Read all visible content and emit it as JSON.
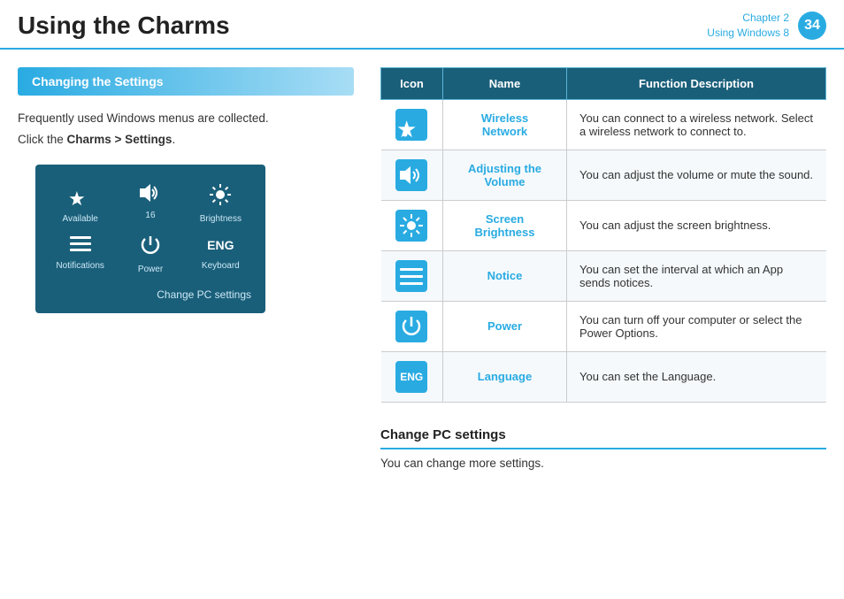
{
  "header": {
    "title": "Using the Charms",
    "chapter_line1": "Chapter 2",
    "chapter_line2": "Using Windows 8",
    "page_number": "34"
  },
  "section": {
    "heading": "Changing the Settings",
    "intro1": "Frequently used Windows menus are collected.",
    "intro2_prefix": "Click the ",
    "intro2_bold": "Charms > Settings",
    "intro2_suffix": "."
  },
  "settings_panel": {
    "items": [
      {
        "icon": "★",
        "label": "Available",
        "id": "wireless"
      },
      {
        "icon": "🔊",
        "label": "16",
        "id": "volume"
      },
      {
        "icon": "☀",
        "label": "Brightness",
        "id": "brightness"
      },
      {
        "icon": "☰",
        "label": "Notifications",
        "id": "notifications"
      },
      {
        "icon": "⏻",
        "label": "Power",
        "id": "power"
      },
      {
        "icon": "ENG",
        "label": "Keyboard",
        "id": "keyboard"
      }
    ],
    "change_pc": "Change PC settings"
  },
  "table": {
    "headers": [
      "Icon",
      "Name",
      "Function Description"
    ],
    "rows": [
      {
        "icon": "★",
        "icon_type": "wireless",
        "name": "Wireless\nNetwork",
        "desc": "You can connect to a wireless network. Select a wireless network to connect to."
      },
      {
        "icon": "🔊",
        "icon_type": "volume",
        "name": "Adjusting the\nVolume",
        "desc": "You can adjust the volume or mute the sound."
      },
      {
        "icon": "☀",
        "icon_type": "brightness",
        "name": "Screen\nBrightness",
        "desc": "You can adjust the screen brightness."
      },
      {
        "icon": "☰",
        "icon_type": "notice",
        "name": "Notice",
        "desc": "You can set the interval at which an App sends notices."
      },
      {
        "icon": "⏻",
        "icon_type": "power",
        "name": "Power",
        "desc": "You can turn off your computer or select the Power Options."
      },
      {
        "icon": "ENG",
        "icon_type": "language",
        "name": "Language",
        "desc": "You can set the Language."
      }
    ]
  },
  "change_pc_section": {
    "title": "Change PC settings",
    "desc": "You can change more settings."
  }
}
